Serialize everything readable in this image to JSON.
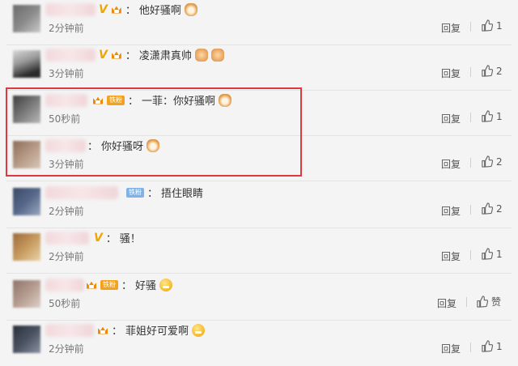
{
  "comments": [
    {
      "text": "他好骚啊",
      "time": "2分钟前",
      "likes": "1",
      "vip": "V",
      "badge": "",
      "emoji": "cat"
    },
    {
      "text": "凌潇肃真帅",
      "time": "3分钟前",
      "likes": "2",
      "vip": "V",
      "badge": "",
      "emoji": "hands"
    },
    {
      "text": "一菲：你好骚啊",
      "time": "50秒前",
      "likes": "1",
      "vip": "",
      "badge": "铁粉",
      "emoji": "cat"
    },
    {
      "text": "你好骚呀",
      "time": "3分钟前",
      "likes": "2",
      "vip": "",
      "badge": "",
      "emoji": "cat"
    },
    {
      "text": "捂住眼睛",
      "time": "2分钟前",
      "likes": "2",
      "vip": "",
      "badge": "铁粉",
      "emoji": ""
    },
    {
      "text": "骚！",
      "time": "2分钟前",
      "likes": "1",
      "vip": "V",
      "badge": "",
      "emoji": ""
    },
    {
      "text": "好骚",
      "time": "50秒前",
      "likes": "赞",
      "vip": "",
      "badge": "铁粉",
      "emoji": "grin"
    },
    {
      "text": "菲姐好可爱啊",
      "time": "2分钟前",
      "likes": "1",
      "vip": "",
      "badge": "",
      "emoji": "grin"
    }
  ],
  "reply_label": "回复",
  "colon": "：",
  "colors": {
    "highlight_border": "#e0383e",
    "vip_gold": "#f0a500",
    "badge_orange": "#f2a21e",
    "badge_blue": "#7fb3e8",
    "background": "#f4f4f4"
  },
  "icons": {
    "like": "thumbs-up-icon",
    "crown": "crown-icon",
    "emoji": "emoji-icon"
  }
}
